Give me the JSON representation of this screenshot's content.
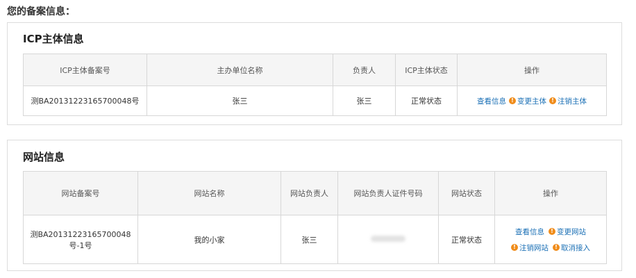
{
  "page": {
    "heading": "您的备案信息："
  },
  "icp": {
    "title": "ICP主体信息",
    "headers": [
      "ICP主体备案号",
      "主办单位名称",
      "负责人",
      "ICP主体状态",
      "操作"
    ],
    "row": {
      "record_no": "测BA20131223165700048号",
      "org_name": "张三",
      "owner": "张三",
      "status": "正常状态",
      "ops": {
        "view": "查看信息",
        "change": "变更主体",
        "cancel": "注销主体"
      }
    }
  },
  "site": {
    "title": "网站信息",
    "headers": [
      "网站备案号",
      "网站名称",
      "网站负责人",
      "网站负责人证件号码",
      "网站状态",
      "操作"
    ],
    "row": {
      "record_no": "测BA20131223165700048号-1号",
      "site_name": "我的小家",
      "owner": "张三",
      "status": "正常状态",
      "ops": {
        "view": "查看信息",
        "change": "变更网站",
        "cancel": "注销网站",
        "unlink": "取消接入"
      }
    }
  },
  "colors": {
    "link": "#1a6fb5",
    "warning": "#f08c1a",
    "header_bg": "#f5f5f5",
    "border": "#d7d7d7"
  },
  "icons": {
    "warning": "warning-circle-icon",
    "warning_glyph": "!"
  }
}
